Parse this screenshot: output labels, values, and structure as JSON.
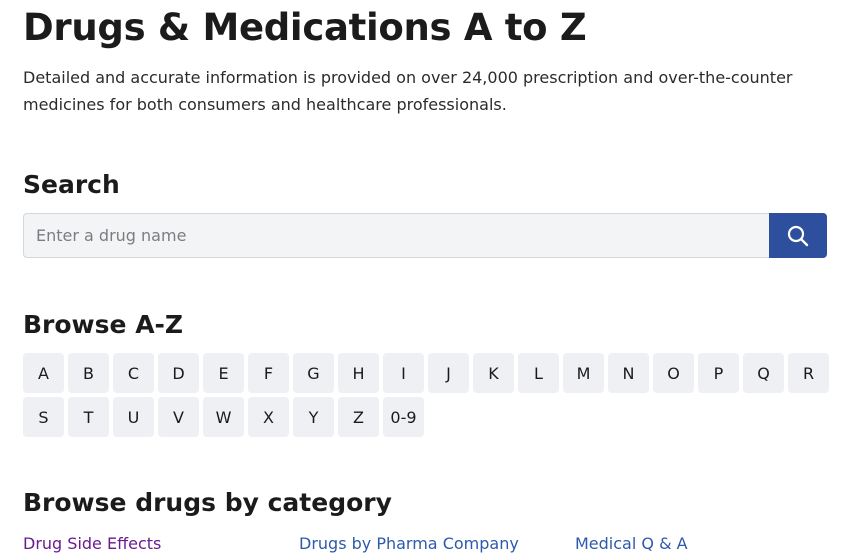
{
  "header": {
    "title": "Drugs & Medications A to Z",
    "intro": "Detailed and accurate information is provided on over 24,000 prescription and over-the-counter medicines for both consumers and healthcare professionals."
  },
  "search": {
    "heading": "Search",
    "placeholder": "Enter a drug name",
    "button_icon": "search-icon",
    "button_color": "#2e4f9e"
  },
  "browse": {
    "heading": "Browse A-Z",
    "row1": [
      "A",
      "B",
      "C",
      "D",
      "E",
      "F",
      "G",
      "H",
      "I",
      "J",
      "K",
      "L",
      "M",
      "N",
      "O",
      "P",
      "Q",
      "R"
    ],
    "row2": [
      "S",
      "T",
      "U",
      "V",
      "W",
      "X",
      "Y",
      "Z",
      "0-9"
    ]
  },
  "categories": {
    "heading": "Browse drugs by category",
    "links": [
      "Drug Side Effects",
      "Drugs by Pharma Company",
      "Medical Q & A"
    ]
  },
  "colors": {
    "link": "#2e5aac",
    "visited_link": "#6a1b8f",
    "letter_bg": "#eef0f3"
  }
}
